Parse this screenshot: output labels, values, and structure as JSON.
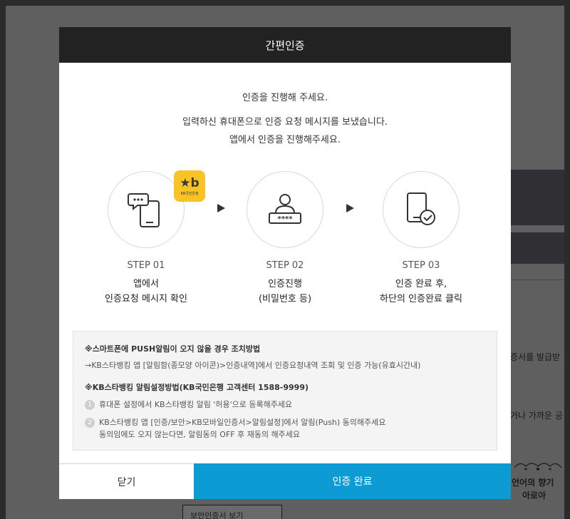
{
  "background": {
    "text1": "증서를 발급받",
    "text2": "거나 가까운 공",
    "brand_line1": "언어의 향기",
    "brand_line2": "아로아",
    "button_label": "보안인증서 보기"
  },
  "modal": {
    "title": "간편인증",
    "intro": {
      "line1": "인증을 진행해 주세요.",
      "line2": "입력하신 휴대폰으로 인증 요청 메시지를 보냈습니다.",
      "line3": "앱에서 인증을 진행해주세요."
    },
    "badge": {
      "mark": "★b",
      "name": "KB국민은행"
    },
    "steps": [
      {
        "label": "STEP 01",
        "desc1": "앱에서",
        "desc2": "인증요청 메시지 확인",
        "icon": "chat-phone-icon"
      },
      {
        "label": "STEP 02",
        "desc1": "인증진행",
        "desc2": "(비밀번호 등)",
        "icon": "user-password-icon"
      },
      {
        "label": "STEP 03",
        "desc1": "인증 완료 후,",
        "desc2": "하단의 인증완료 클릭",
        "icon": "phone-check-icon"
      }
    ],
    "notice": {
      "title1": "※스마트폰에 PUSH알림이 오지 않을 경우 조치방법",
      "text1": "→KB스타뱅킹 앱 [알림함(종모양 아이콘)>인증내역]에서 인증요청내역 조회 및 인증 가능(유효시간내)",
      "title2": "※KB스타뱅킹 알림설정방법(KB국민은행 고객센터 1588-9999)",
      "items": [
        {
          "num": "1",
          "text": "휴대폰 설정에서 KB스타뱅킹 알림 '허용'으로 등록해주세요"
        },
        {
          "num": "2",
          "text": "KB스타뱅킹 앱 [인증/보안>KB모바일인증서>알림설정]에서 알림(Push) 동의해주세요",
          "text2": "동의임에도 오지 않는다면, 알림동의 OFF 후 재동의 해주세요"
        }
      ]
    },
    "close_label": "닫기",
    "confirm_label": "인증 완료"
  },
  "colors": {
    "header_bg": "#222222",
    "confirm_bg": "#0c9bd3",
    "kb_yellow": "#f7c325",
    "overlay": "#5f5f5f"
  }
}
